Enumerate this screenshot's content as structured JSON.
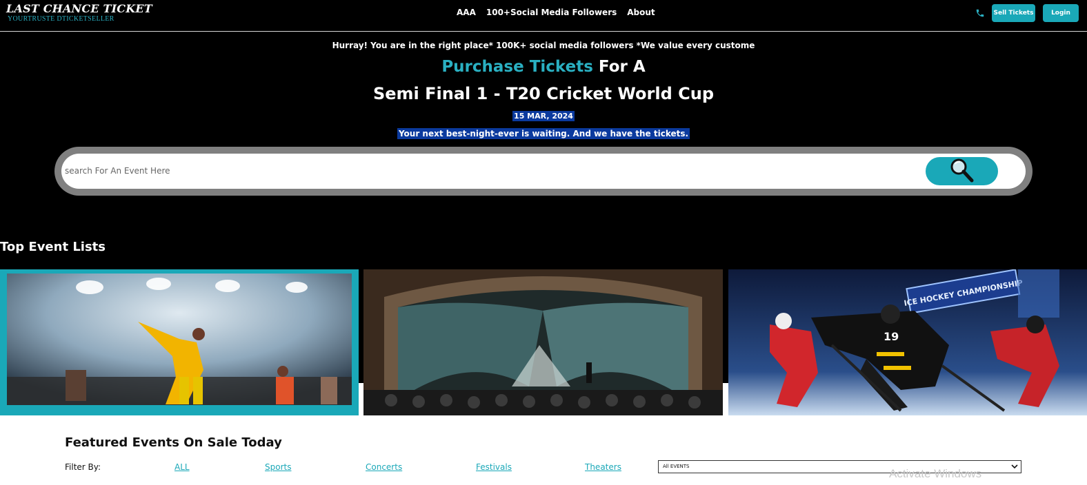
{
  "header": {
    "logo_title": "LAST CHANCE TICKET",
    "logo_subtitle": "YOURTRUSTE DTICKETSELLER",
    "nav": [
      {
        "label": "AAA"
      },
      {
        "label": "100+Social Media Followers"
      },
      {
        "label": "About"
      }
    ],
    "sell_label": "Sell Tickets",
    "login_label": "Login"
  },
  "hero": {
    "tagline": "Hurray! You are in the right place* 100K+ social media followers *We value every custome",
    "headline_accent": "Purchase Tickets",
    "headline_rest": " For A",
    "event_title": "Semi Final 1 - T20 Cricket World Cup",
    "event_date": "15 MAR, 2024",
    "subline": "Your next best-night-ever is waiting. And we have the tickets."
  },
  "search": {
    "placeholder": "search For An Event Here"
  },
  "top_events": {
    "title": "Top Event Lists",
    "cards": [
      {
        "image": "concert-performer"
      },
      {
        "image": "theater-stage"
      },
      {
        "image": "ice-hockey",
        "banner_text": "ICE HOCKEY CHAMPIONSHIP",
        "jersey": "19"
      }
    ]
  },
  "featured": {
    "title": "Featured Events On Sale Today",
    "filter_label": "Filter By:",
    "filters": [
      "ALL",
      "Sports",
      "Concerts",
      "Festivals",
      "Theaters"
    ],
    "select_value": "All EVENTS"
  },
  "os": {
    "watermark": "Activate Windows"
  },
  "colors": {
    "accent": "#1aa8b8",
    "highlight": "#0b3a9e"
  }
}
